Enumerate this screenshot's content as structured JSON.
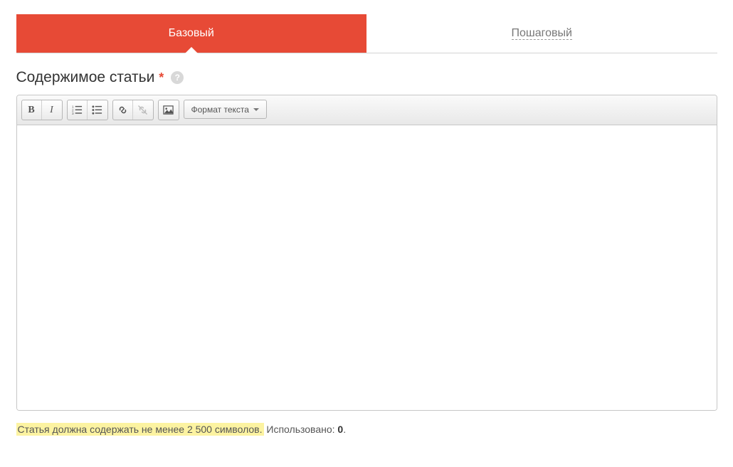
{
  "tabs": {
    "basic": "Базовый",
    "stepbystep": "Пошаговый"
  },
  "field": {
    "label": "Содержимое статьи",
    "required_mark": "*",
    "help_glyph": "?"
  },
  "toolbar": {
    "format_label": "Формат текста"
  },
  "footer": {
    "min_chars_msg": "Статья должна содержать не менее 2 500 символов.",
    "used_label": " Использовано: ",
    "used_count": "0",
    "period": "."
  }
}
